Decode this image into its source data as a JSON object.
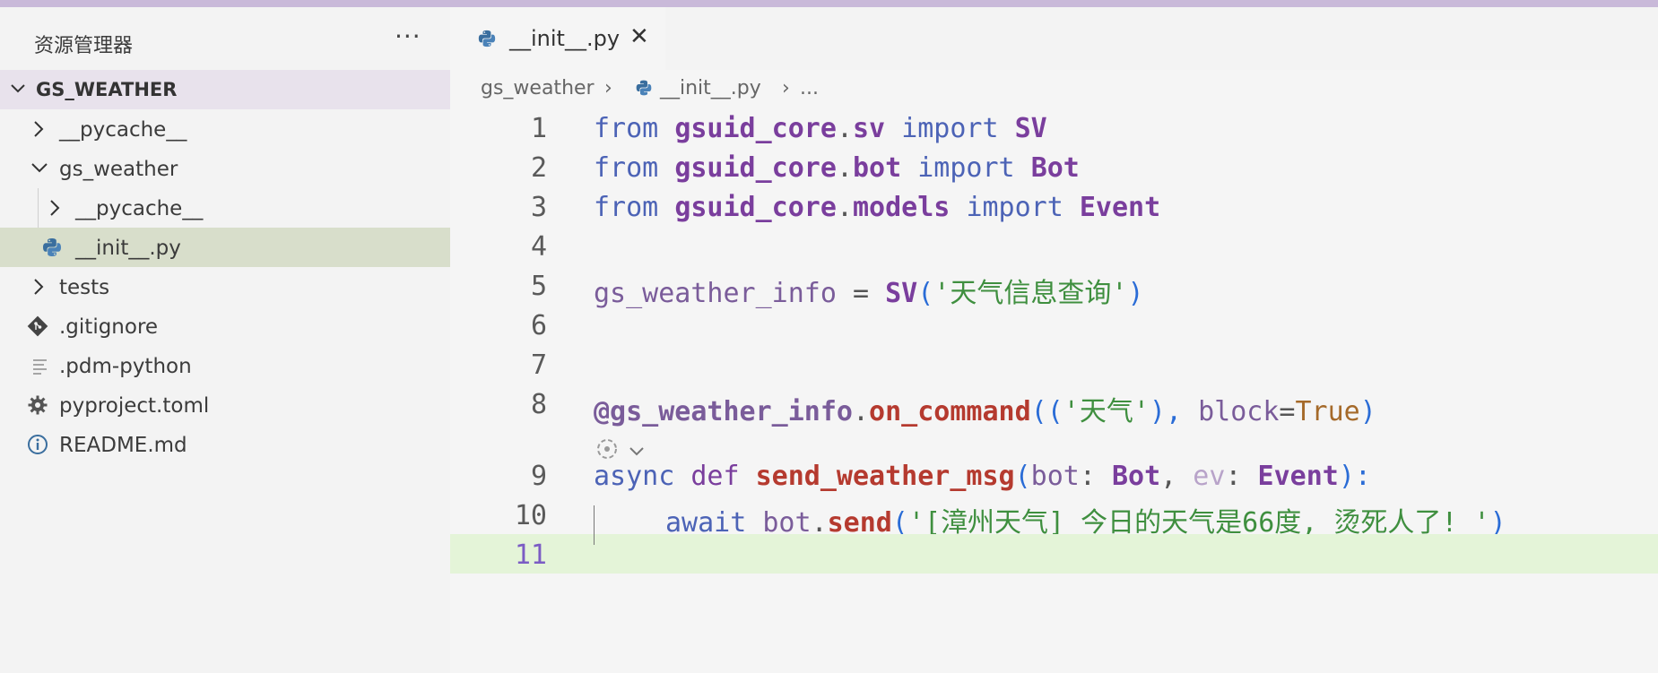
{
  "sidebar": {
    "title": "资源管理器",
    "more_label": "···",
    "section_label": "GS_WEATHER",
    "items": [
      {
        "label": "__pycache__"
      },
      {
        "label": "gs_weather"
      },
      {
        "label": "__pycache__"
      },
      {
        "label": "__init__.py"
      },
      {
        "label": "tests"
      },
      {
        "label": ".gitignore"
      },
      {
        "label": ".pdm-python"
      },
      {
        "label": "pyproject.toml"
      },
      {
        "label": "README.md"
      }
    ]
  },
  "editor": {
    "tab": {
      "label": "__init__.py",
      "close": "✕"
    },
    "breadcrumb": {
      "folder": "gs_weather",
      "sep1": "›",
      "file": "__init__.py",
      "sep2": "›",
      "ellipsis": "..."
    },
    "line_numbers": [
      "1",
      "2",
      "3",
      "4",
      "5",
      "6",
      "7",
      "8",
      "9",
      "10",
      "11"
    ],
    "code": {
      "l1": {
        "t1": "from",
        "t2": "gsuid_core",
        "t3": ".",
        "t4": "sv",
        "t5": "import",
        "t6": "SV"
      },
      "l2": {
        "t1": "from",
        "t2": "gsuid_core",
        "t3": ".",
        "t4": "bot",
        "t5": "import",
        "t6": "Bot"
      },
      "l3": {
        "t1": "from",
        "t2": "gsuid_core",
        "t3": ".",
        "t4": "models",
        "t5": "import",
        "t6": "Event"
      },
      "l5": {
        "t1": "gs_weather_info",
        "t2": " = ",
        "t3": "SV",
        "t4": "(",
        "t5": "'天气信息查询'",
        "t6": ")"
      },
      "l8": {
        "t1": "@gs_weather_info",
        "t2": ".",
        "t3": "on_command",
        "t4": "((",
        "t5": "'天气'",
        "t6": "), ",
        "t7": "block",
        "t8": "=",
        "t9": "True",
        "t10": ")"
      },
      "l9": {
        "t1": "async",
        "t2": "def",
        "t3": "send_weather_msg",
        "t4": "(",
        "t5": "bot",
        "t6": ": ",
        "t7": "Bot",
        "t8": ", ",
        "t9": "ev",
        "t10": ": ",
        "t11": "Event",
        "t12": "):"
      },
      "l10": {
        "t1": "await",
        "t2": "bot",
        "t3": ".",
        "t4": "send",
        "t5": "(",
        "t6": "'[漳州天气] 今日的天气是66度, 烫死人了! '",
        "t7": ")"
      }
    }
  },
  "colors": {
    "topbar": "#c9b9d9",
    "selected_row": "#d8decb",
    "active_line": "#e4f4d8"
  }
}
